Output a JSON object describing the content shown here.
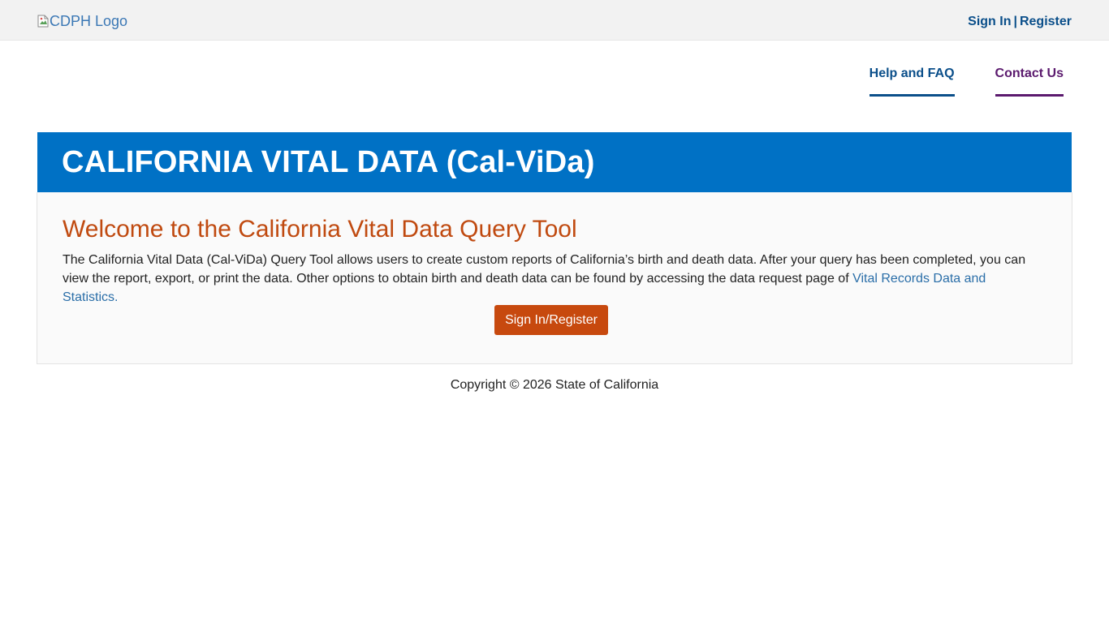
{
  "header": {
    "logo_alt": "CDPH Logo",
    "sign_in": "Sign In",
    "separator": "|",
    "register": "Register"
  },
  "nav": {
    "items": [
      {
        "label": "Help and FAQ",
        "color": "#0b4f8a"
      },
      {
        "label": "Contact Us",
        "color": "#5b1a6e"
      }
    ]
  },
  "banner": {
    "title": "CALIFORNIA VITAL DATA (Cal-ViDa)",
    "background": "#0071c5"
  },
  "main": {
    "heading": "Welcome to the California Vital Data Query Tool",
    "description": "The California Vital Data (Cal-ViDa) Query Tool allows users to create custom reports of California’s birth and death data. After your query has been completed, you can view the report, export, or print the data. Other options to obtain birth and death data can be found by accessing the data request page of ",
    "link_text": "Vital Records Data and Statistics.",
    "button_label": "Sign In/Register",
    "button_color": "#c7490e"
  },
  "footer": {
    "copyright": "Copyright © 2026 State of California"
  }
}
